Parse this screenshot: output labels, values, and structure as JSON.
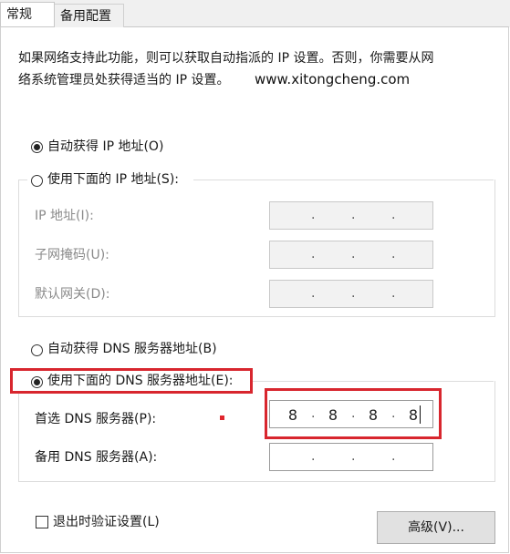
{
  "tabs": [
    {
      "label": "常规",
      "active": true
    },
    {
      "label": "备用配置",
      "active": false
    }
  ],
  "description": {
    "line1": "如果网络支持此功能，则可以获取自动指派的 IP 设置。否则，你需要从网",
    "line2": "络系统管理员处获得适当的 IP 设置。",
    "watermark": "www.xitongcheng.com"
  },
  "ip": {
    "auto_label": "自动获得 IP 地址(O)",
    "auto_selected": true,
    "manual_label": "使用下面的 IP 地址(S):",
    "manual_selected": false,
    "fields": [
      {
        "label": "IP 地址(I):",
        "value": ""
      },
      {
        "label": "子网掩码(U):",
        "value": ""
      },
      {
        "label": "默认网关(D):",
        "value": ""
      }
    ]
  },
  "dns": {
    "auto_label": "自动获得 DNS 服务器地址(B)",
    "auto_selected": false,
    "manual_label": "使用下面的 DNS 服务器地址(E):",
    "manual_selected": true,
    "preferred": {
      "label": "首选 DNS 服务器(P):",
      "octets": [
        "8",
        "8",
        "8",
        "8"
      ]
    },
    "alternate": {
      "label": "备用 DNS 服务器(A):",
      "octets": [
        "",
        "",
        "",
        ""
      ]
    }
  },
  "footer": {
    "validate_label": "退出时验证设置(L)",
    "validate_checked": false,
    "advanced_label": "高级(V)..."
  },
  "colors": {
    "highlight": "#d8262e"
  }
}
